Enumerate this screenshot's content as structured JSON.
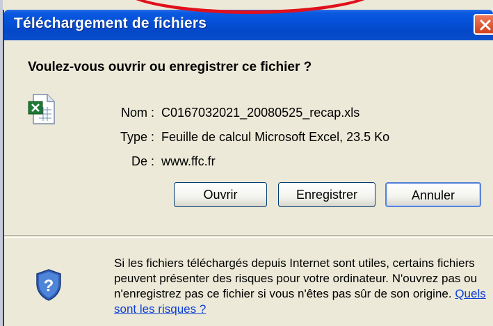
{
  "window": {
    "title": "Téléchargement de fichiers"
  },
  "prompt": {
    "question": "Voulez-vous ouvrir ou enregistrer ce fichier ?"
  },
  "file": {
    "icon": "excel-file-icon",
    "name_label": "Nom :",
    "name_value": "C0167032021_20080525_recap.xls",
    "type_label": "Type :",
    "type_value": "Feuille de calcul Microsoft Excel, 23.5 Ko",
    "from_label": "De :",
    "from_value": "www.ffc.fr"
  },
  "buttons": {
    "open": "Ouvrir",
    "save": "Enregistrer",
    "cancel": "Annuler"
  },
  "warning": {
    "icon": "shield-question-icon",
    "text": "Si les fichiers téléchargés depuis Internet sont utiles, certains fichiers peuvent présenter des risques pour votre ordinateur. N'ouvrez pas ou n'enregistrez pas ce fichier si vous n'êtes pas sûr de son origine. ",
    "link": "Quels sont les risques ?"
  },
  "colors": {
    "titlebar": "#0550d8",
    "highlight": "#e0101c",
    "link": "#0b3fd6"
  }
}
